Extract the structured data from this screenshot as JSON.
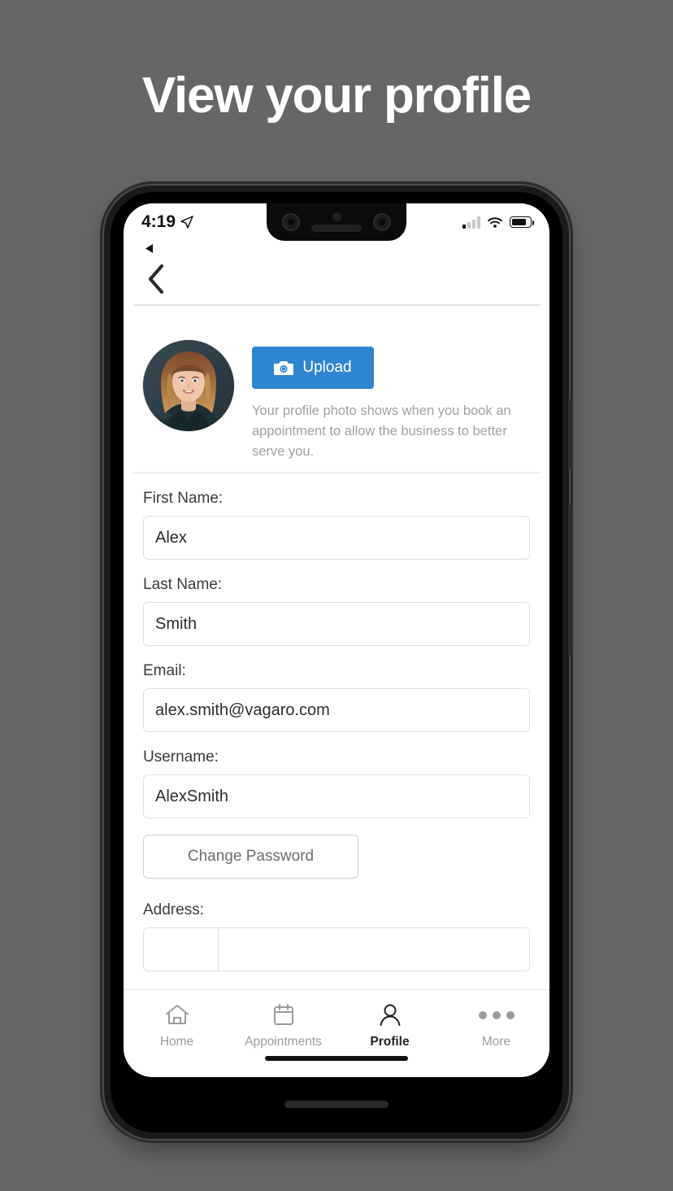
{
  "headline": "View your profile",
  "status_bar": {
    "time": "4:19",
    "location_icon": "location-arrow-icon",
    "signal_icon": "cellular-signal-icon",
    "wifi_icon": "wifi-icon",
    "battery_icon": "battery-icon"
  },
  "nav": {
    "ios_back_indicator": "back-triangle-icon",
    "back_icon": "chevron-left-icon"
  },
  "photo_section": {
    "avatar_alt": "user-profile-photo",
    "upload_label": "Upload",
    "camera_icon": "camera-icon",
    "note": "Your profile photo shows when you book an appointment to allow the business to better serve you."
  },
  "form": {
    "fields": [
      {
        "label": "First Name:",
        "value": "Alex",
        "name": "first-name"
      },
      {
        "label": "Last Name:",
        "value": "Smith",
        "name": "last-name"
      },
      {
        "label": "Email:",
        "value": "alex.smith@vagaro.com",
        "name": "email"
      },
      {
        "label": "Username:",
        "value": "AlexSmith",
        "name": "username"
      }
    ],
    "change_password_label": "Change Password",
    "address_label": "Address:"
  },
  "tabbar": {
    "tabs": [
      {
        "label": "Home",
        "icon": "home-icon",
        "active": false
      },
      {
        "label": "Appointments",
        "icon": "calendar-icon",
        "active": false
      },
      {
        "label": "Profile",
        "icon": "person-icon",
        "active": true
      },
      {
        "label": "More",
        "icon": "ellipsis-icon",
        "active": true
      }
    ]
  },
  "colors": {
    "background": "#666666",
    "accent_blue": "#2f85d0",
    "headline": "#ffffff",
    "note_text": "#a0a0a0",
    "active_tab": "#222222",
    "inactive_tab": "#9b9b9b"
  }
}
